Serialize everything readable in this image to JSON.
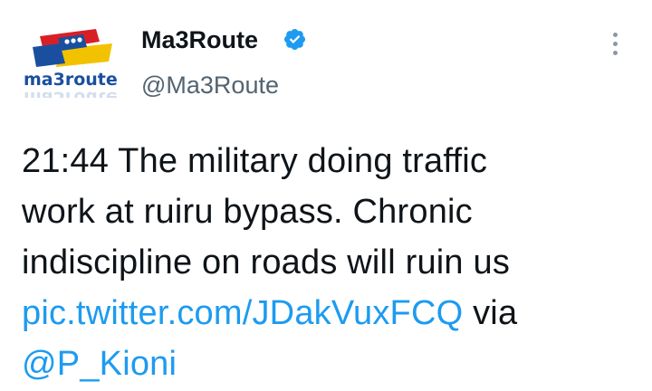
{
  "author": {
    "display_name": "Ma3Route",
    "handle": "@Ma3Route",
    "avatar_label": "ma3route",
    "verified": true
  },
  "icons": {
    "verified": "verified-badge-icon",
    "more": "more-options-icon"
  },
  "tweet": {
    "line1": "21:44 The military doing traffic",
    "line2": "work at ruiru bypass. Chronic",
    "line3": "indiscipline on roads will ruin us",
    "link": "pic.twitter.com/JDakVuxFCQ",
    "via": " via",
    "mention": "@P_Kioni"
  },
  "colors": {
    "link": "#1d9bf0",
    "verified": "#1d9bf0",
    "text": "#0f1419",
    "handle": "#536471"
  }
}
